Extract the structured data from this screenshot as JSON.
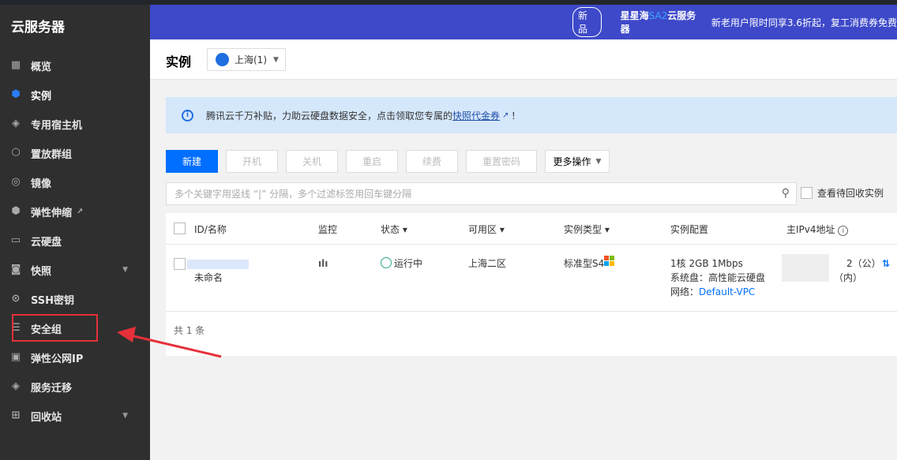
{
  "sidebar": {
    "title": "云服务器",
    "items": [
      {
        "label": "概览",
        "icon": "grid-icon"
      },
      {
        "label": "实例",
        "icon": "cube-icon",
        "active": true
      },
      {
        "label": "专用宿主机",
        "icon": "layers-icon"
      },
      {
        "label": "置放群组",
        "icon": "hexagon-icon"
      },
      {
        "label": "镜像",
        "icon": "disc-icon"
      },
      {
        "label": "弹性伸缩",
        "icon": "scale-icon",
        "external": true
      },
      {
        "label": "云硬盘",
        "icon": "disk-icon"
      },
      {
        "label": "快照",
        "icon": "camera-icon",
        "caret": true
      },
      {
        "label": "SSH密钥",
        "icon": "key-icon"
      },
      {
        "label": "安全组",
        "icon": "shield-icon"
      },
      {
        "label": "弹性公网IP",
        "icon": "ip-icon"
      },
      {
        "label": "服务迁移",
        "icon": "migrate-icon"
      },
      {
        "label": "回收站",
        "icon": "trash-icon",
        "caret": true
      }
    ]
  },
  "banner": {
    "badge": "新品",
    "product_a": "星星海",
    "product_b": "SA2",
    "product_c": "云服务器",
    "text": "新老用户限时同享3.6折起，复工消费券免费"
  },
  "header": {
    "title": "实例",
    "region": "上海(1)"
  },
  "notice": {
    "text": "腾讯云千万补贴，力助云硬盘数据安全，点击领取您专属的",
    "link": "快照代金券",
    "suffix": "！"
  },
  "toolbar": {
    "buttons": [
      "新建",
      "开机",
      "关机",
      "重启",
      "续费",
      "重置密码"
    ],
    "more": "更多操作"
  },
  "search": {
    "placeholder": "多个关键字用竖线 “|” 分隔，多个过滤标签用回车键分隔",
    "recycle_label": "查看待回收实例"
  },
  "table": {
    "headers": [
      "ID/名称",
      "监控",
      "状态",
      "可用区",
      "实例类型",
      "实例配置",
      "主IPv4地址"
    ],
    "row": {
      "name": "未命名",
      "status": "运行中",
      "zone": "上海二区",
      "type": "标准型S4",
      "config": [
        "1核 2GB 1Mbps",
        "系统盘：高性能云硬盘",
        "网络："
      ],
      "vpc": "Default-VPC",
      "ip_public": "2（公）",
      "ip_private": "（内）"
    },
    "footer": "共 1 条"
  },
  "colors": {
    "accent": "#006eff",
    "banner": "#3d49c9",
    "sidebar": "#2f2f2f",
    "running": "#29a58a",
    "highlight": "#e5303a"
  }
}
